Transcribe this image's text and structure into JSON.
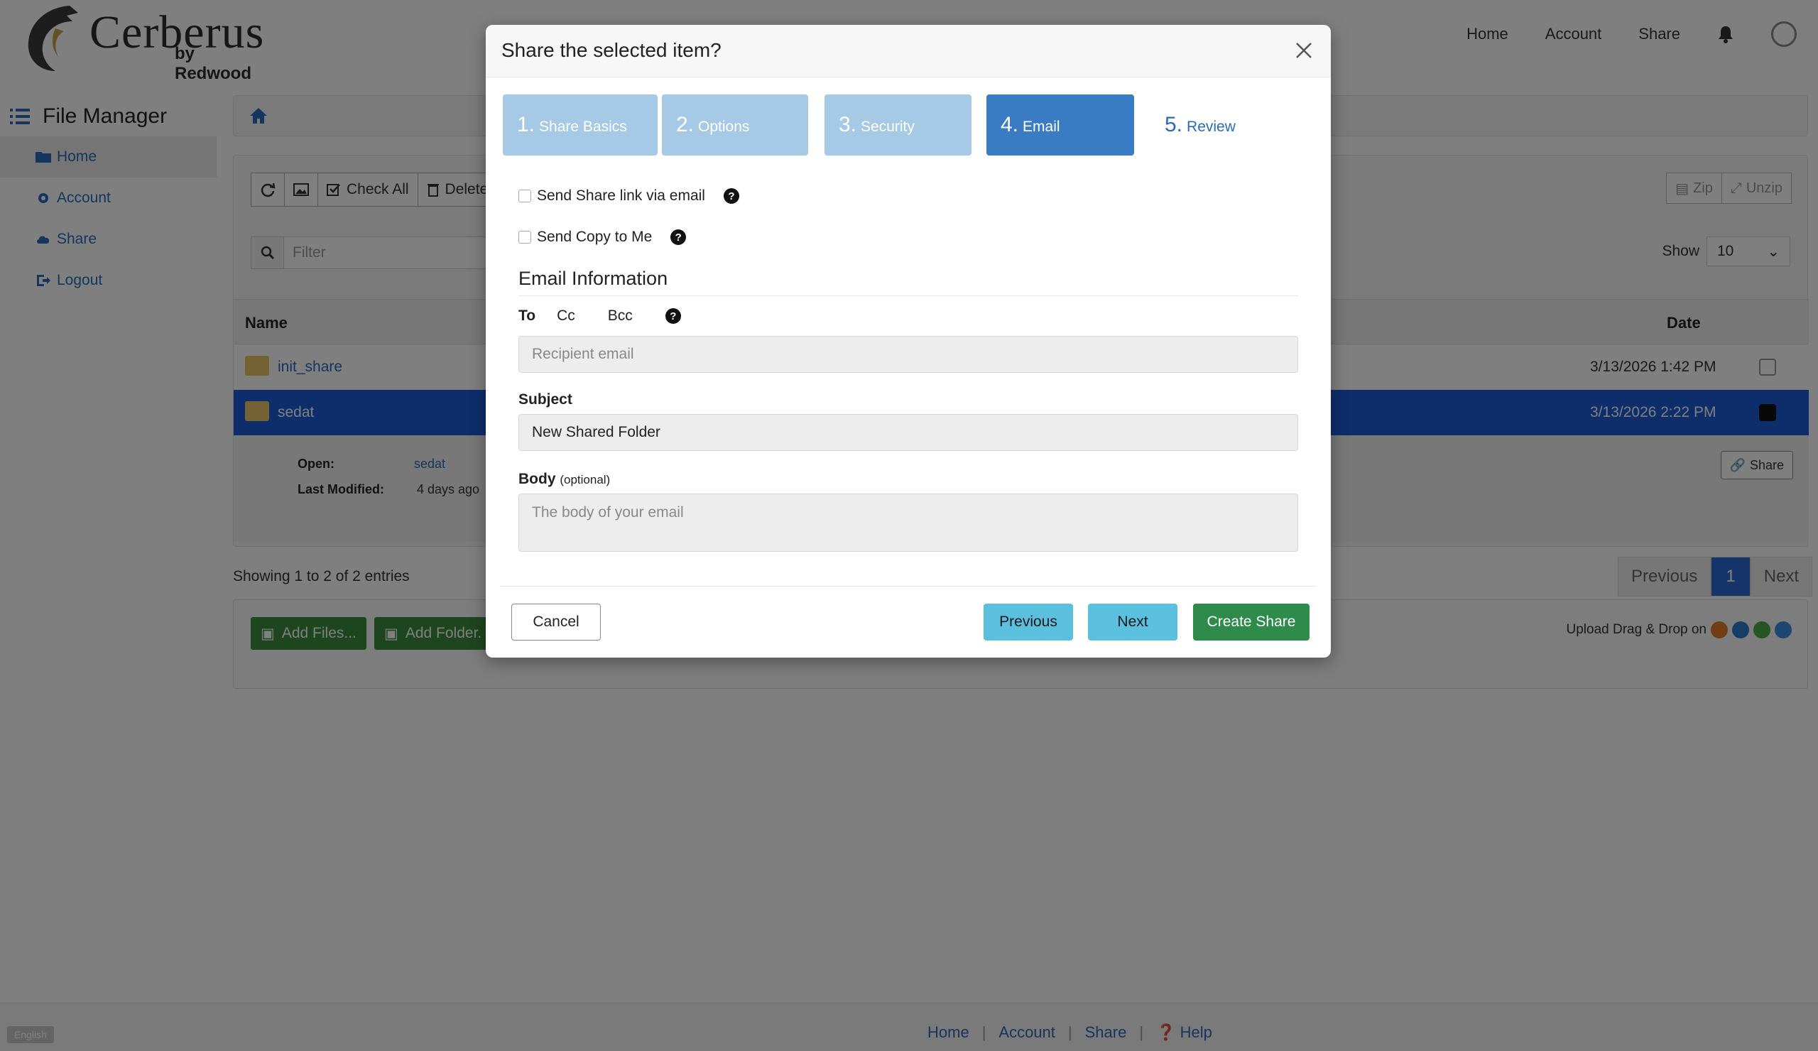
{
  "app": {
    "brand": "Cerberus",
    "brand_sub": "by Redwood",
    "topnav": [
      "Home",
      "Account",
      "Share"
    ],
    "sidebar_title": "File Manager",
    "sidebar": [
      "Home",
      "Account",
      "Share",
      "Logout"
    ],
    "toolbar": {
      "check_all": "Check All",
      "delete": "Delete",
      "zip": "Zip",
      "unzip": "Unzip"
    },
    "filter_placeholder": "Filter",
    "show_label": "Show",
    "show_value": "10",
    "table": {
      "col_name": "Name",
      "col_date": "Date",
      "rows": [
        {
          "name": "init_share",
          "date": "3/13/2026 1:42 PM"
        },
        {
          "name": "sedat",
          "date": "3/13/2026 2:22 PM"
        }
      ],
      "detail": {
        "open_label": "Open:",
        "open_value": "sedat",
        "modified_label": "Last Modified:",
        "modified_value": "4 days ago",
        "share_btn": "Share"
      }
    },
    "entries": "Showing 1 to 2 of 2 entries",
    "pager": {
      "prev": "Previous",
      "page": "1",
      "next": "Next"
    },
    "upload": {
      "add_files": "Add Files...",
      "add_folder": "Add Folder.",
      "drag_drop": "Upload Drag & Drop on"
    },
    "footer": {
      "lang": "English",
      "links": [
        "Home",
        "Account",
        "Share",
        "Help"
      ]
    }
  },
  "modal": {
    "title": "Share the selected item?",
    "steps": [
      {
        "num": "1.",
        "label": "Share Basics"
      },
      {
        "num": "2.",
        "label": "Options"
      },
      {
        "num": "3.",
        "label": "Security"
      },
      {
        "num": "4.",
        "label": "Email"
      },
      {
        "num": "5.",
        "label": "Review"
      }
    ],
    "checkbox_send_link": "Send Share link via email",
    "checkbox_send_copy": "Send Copy to Me",
    "section_title": "Email Information",
    "recipients": {
      "to": "To",
      "cc": "Cc",
      "bcc": "Bcc"
    },
    "recipient_placeholder": "Recipient email",
    "subject_label": "Subject",
    "subject_value": "New Shared Folder",
    "body_label": "Body",
    "body_optional": "(optional)",
    "body_placeholder": "The body of your email",
    "buttons": {
      "cancel": "Cancel",
      "previous": "Previous",
      "next": "Next",
      "create": "Create Share"
    }
  },
  "colors": {
    "step_done": "#a6c9e6",
    "step_current": "#3a7cc3",
    "btn_info": "#5bc0de",
    "btn_success": "#2e8b4b",
    "selected_row": "#1b5bd6"
  }
}
